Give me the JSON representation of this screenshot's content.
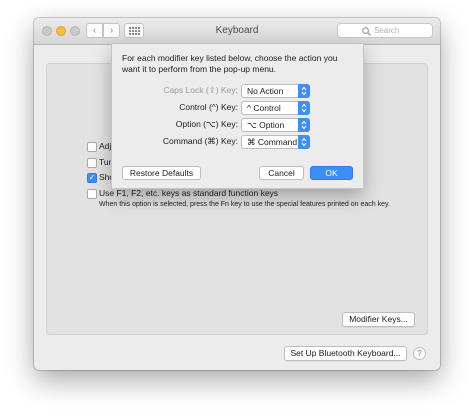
{
  "window": {
    "title": "Keyboard"
  },
  "toolbar": {
    "search_placeholder": "Search"
  },
  "sheet": {
    "intro": "For each modifier key listed below, choose the action you want it to perform from the pop-up menu.",
    "rows": [
      {
        "label": "Caps Lock (⇪) Key:",
        "value": "No Action"
      },
      {
        "label": "Control (^) Key:",
        "value": "^ Control"
      },
      {
        "label": "Option (⌥) Key:",
        "value": "⌥ Option"
      },
      {
        "label": "Command (⌘) Key:",
        "value": "⌘ Command"
      }
    ],
    "restore_label": "Restore Defaults",
    "cancel_label": "Cancel",
    "ok_label": "OK"
  },
  "main": {
    "options": [
      {
        "text": "Adj",
        "checked": false
      },
      {
        "text": "Tur",
        "checked": false
      },
      {
        "text": "Sho",
        "checked": true
      },
      {
        "text": "Use F1, F2, etc. keys as standard function keys",
        "checked": false
      }
    ],
    "fn_note": "When this option is selected, press the Fn key to use the special features printed on each key.",
    "modifier_keys_label": "Modifier Keys...",
    "bluetooth_label": "Set Up Bluetooth Keyboard...",
    "help_label": "?"
  },
  "colors": {
    "accent": "#3d8ff5",
    "window_bg": "#ececec"
  }
}
